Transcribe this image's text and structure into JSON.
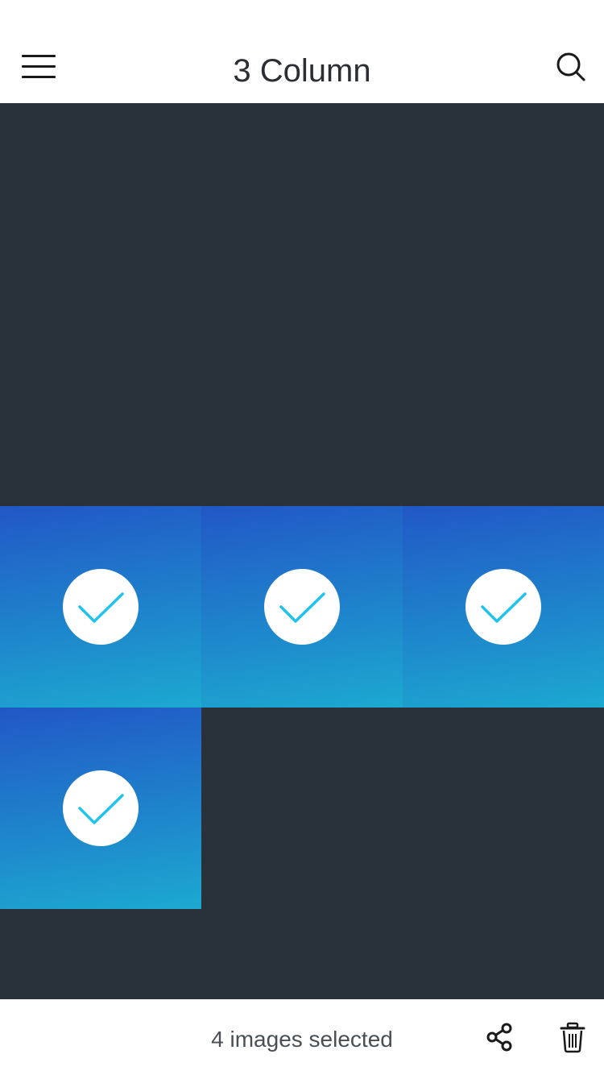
{
  "header": {
    "title": "3 Column",
    "menu_icon": "hamburger-menu-icon",
    "search_icon": "search-icon"
  },
  "grid": {
    "columns": 3,
    "background": "#29323a",
    "selected_gradient": [
      "#2157c6",
      "#1ca9d0"
    ],
    "check_color": "#1fc3ee",
    "tiles": [
      {
        "row": 0,
        "col": 0,
        "selected": false
      },
      {
        "row": 0,
        "col": 1,
        "selected": false
      },
      {
        "row": 0,
        "col": 2,
        "selected": false
      },
      {
        "row": 1,
        "col": 0,
        "selected": false
      },
      {
        "row": 1,
        "col": 1,
        "selected": false
      },
      {
        "row": 1,
        "col": 2,
        "selected": false
      },
      {
        "row": 2,
        "col": 0,
        "selected": true
      },
      {
        "row": 2,
        "col": 1,
        "selected": true
      },
      {
        "row": 2,
        "col": 2,
        "selected": true
      },
      {
        "row": 3,
        "col": 0,
        "selected": true
      },
      {
        "row": 3,
        "col": 1,
        "selected": false
      },
      {
        "row": 3,
        "col": 2,
        "selected": false
      },
      {
        "row": 4,
        "col": 0,
        "selected": false
      },
      {
        "row": 4,
        "col": 1,
        "selected": false
      },
      {
        "row": 4,
        "col": 2,
        "selected": false
      }
    ]
  },
  "bottom_bar": {
    "selection_text": "4 images selected",
    "share_icon": "share-icon",
    "delete_icon": "trash-icon"
  }
}
